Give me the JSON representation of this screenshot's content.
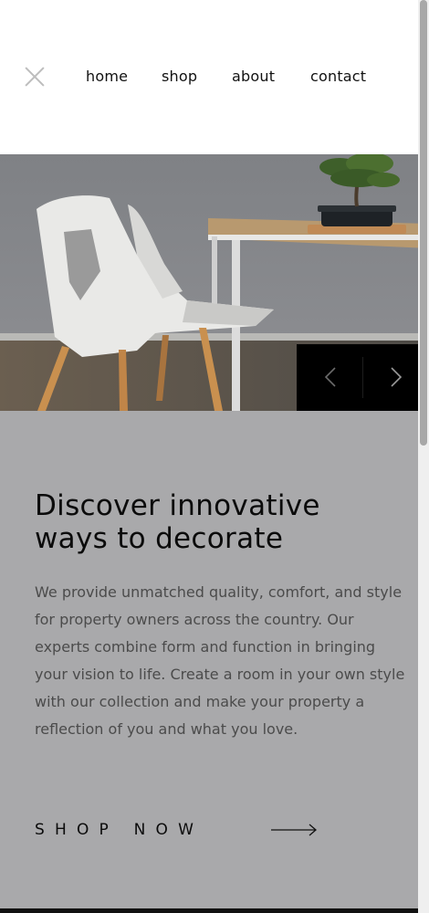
{
  "nav": {
    "close_icon": "close-icon",
    "items": [
      {
        "label": "home"
      },
      {
        "label": "shop"
      },
      {
        "label": "about"
      },
      {
        "label": "contact"
      }
    ]
  },
  "hero": {
    "image": "white-chair-and-table-with-bonsai",
    "prev_icon": "chevron-left-icon",
    "next_icon": "chevron-right-icon"
  },
  "content": {
    "heading": "Discover innovative ways to decorate",
    "body": "We provide unmatched quality, comfort, and style for property owners across the country. Our experts combine form and function in bringing your vision to life. Create a room in your own style with our collection and make your property a reflection of you and what you love.",
    "cta_label": "SHOP NOW",
    "cta_icon": "long-arrow-right-icon"
  },
  "colors": {
    "content_bg": "#a9a9ab",
    "slider_bg": "#000000",
    "text": "#0b0b0b"
  }
}
